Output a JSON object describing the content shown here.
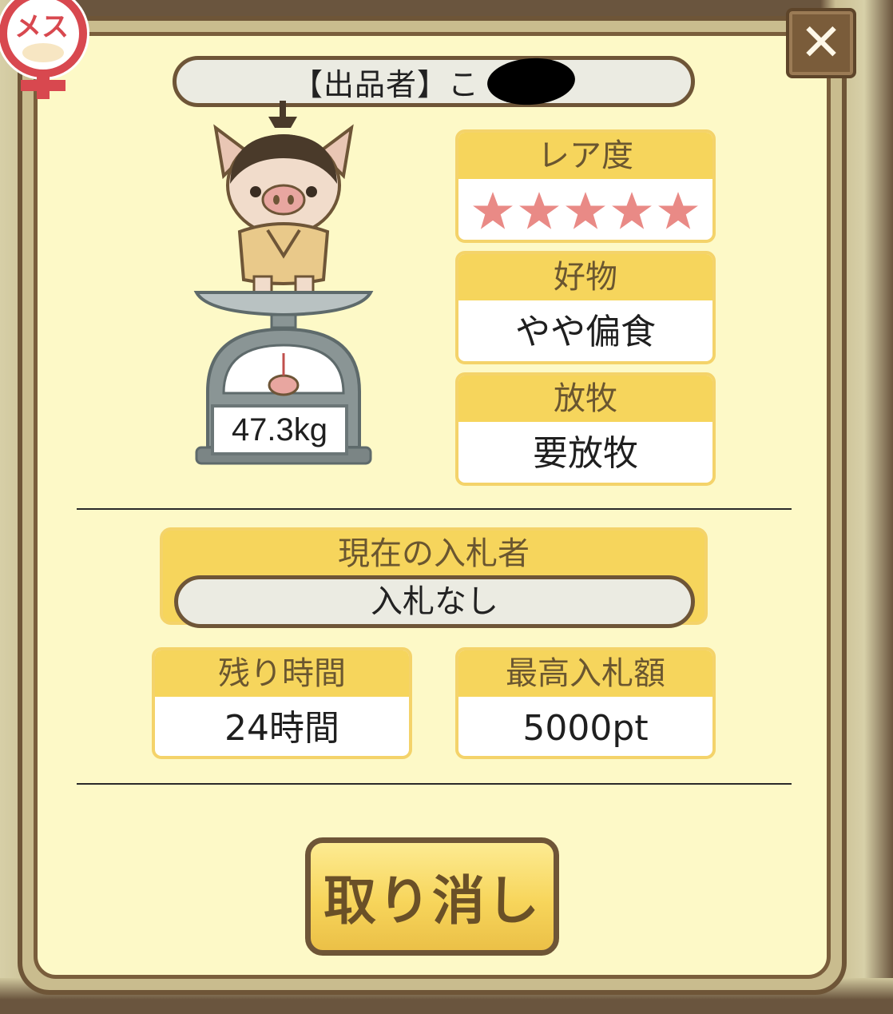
{
  "header": {
    "gender_label": "メス",
    "seller_label": "【出品者】こ",
    "close_label": "✕"
  },
  "pig": {
    "weight": "47.3kg"
  },
  "rarity": {
    "title": "レア度",
    "stars": 5,
    "star_color": "#e98a86"
  },
  "preference": {
    "title": "好物",
    "value": "やや偏食"
  },
  "grazing": {
    "title": "放牧",
    "value": "要放牧"
  },
  "current_bidder": {
    "title": "現在の入札者",
    "value": "入札なし"
  },
  "remaining_time": {
    "title": "残り時間",
    "value": "24時間"
  },
  "highest_bid": {
    "title": "最高入札額",
    "value": "5000pt"
  },
  "actions": {
    "cancel_label": "取り消し"
  },
  "colors": {
    "panel_bg": "#fdf9c7",
    "card_head": "#f6d55c",
    "frame": "#6e5537",
    "gender": "#d8484f"
  }
}
